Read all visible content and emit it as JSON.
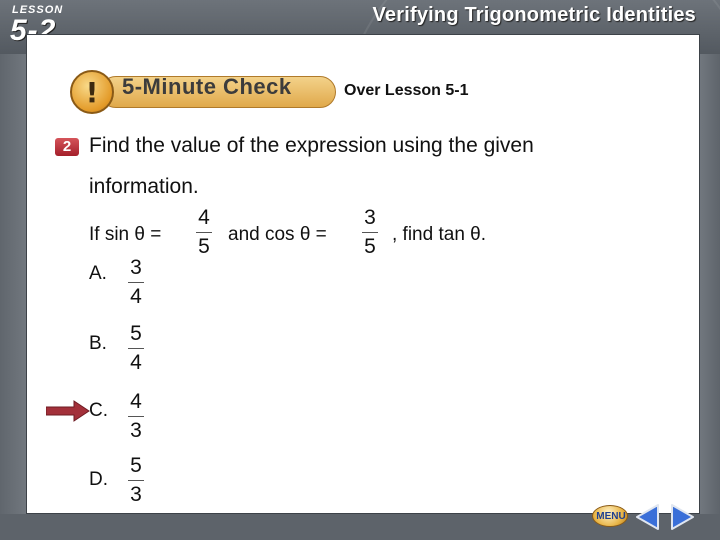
{
  "header": {
    "lesson_word": "LESSON",
    "lesson_number": "5-2",
    "title": "Verifying Trigonometric Identities"
  },
  "check": {
    "label": "5-Minute Check",
    "over_lesson": "Over Lesson 5-1"
  },
  "question": {
    "number": "2",
    "line1": "Find the value of the expression using the given",
    "line2": "information.",
    "given_prefix": "If sin θ =",
    "sin_num": "4",
    "sin_den": "5",
    "given_middle": "and cos θ =",
    "cos_num": "3",
    "cos_den": "5",
    "given_suffix": ", find tan θ."
  },
  "options": [
    {
      "label": "A.",
      "num": "3",
      "den": "4"
    },
    {
      "label": "B.",
      "num": "5",
      "den": "4"
    },
    {
      "label": "C.",
      "num": "4",
      "den": "3"
    },
    {
      "label": "D.",
      "num": "5",
      "den": "3"
    }
  ],
  "selected_option": "C.",
  "nav": {
    "menu_label": "MENU"
  },
  "colors": {
    "badge_red": "#a41f2a",
    "arrow": "#a3303a",
    "check_orange": "#e0a94b",
    "frame_gray": "#5a6068",
    "nav_blue": "#2a56b8"
  }
}
